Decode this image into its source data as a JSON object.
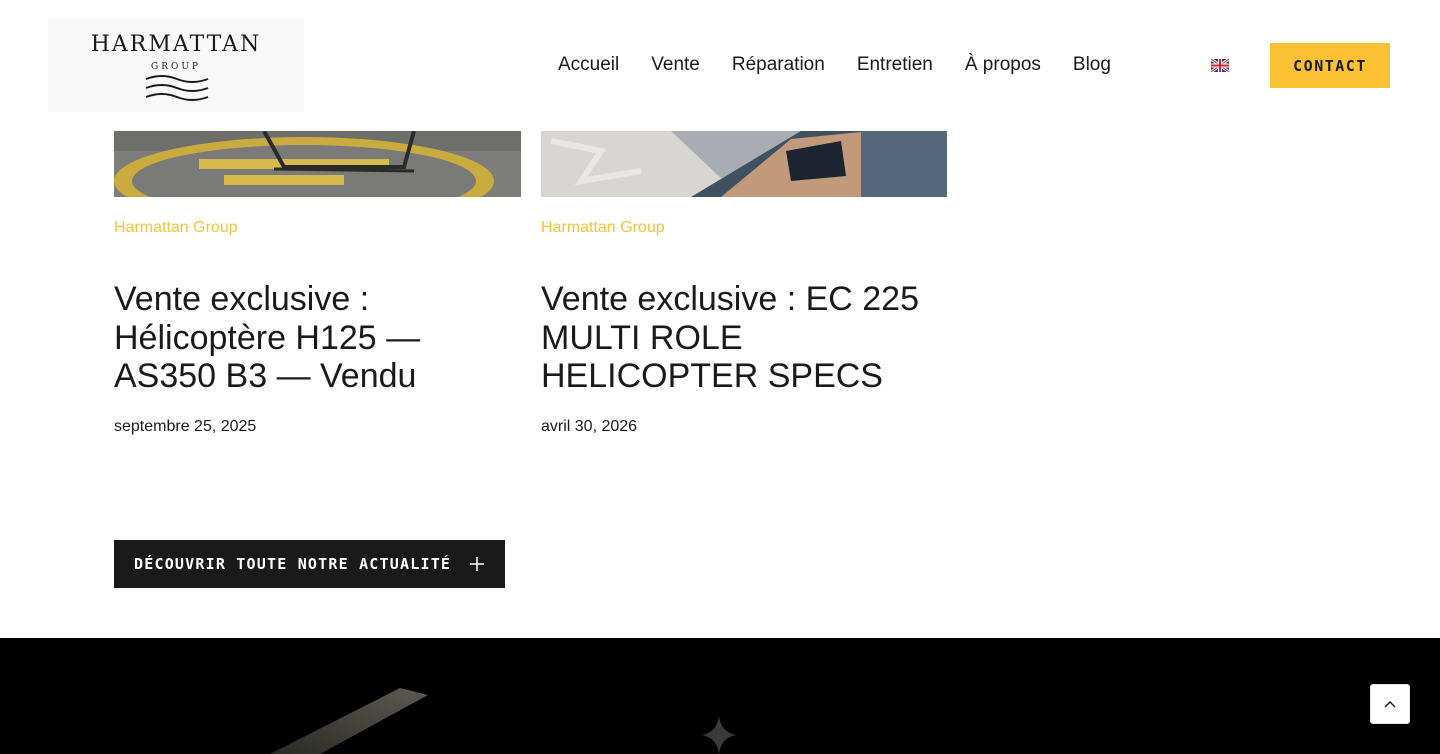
{
  "header": {
    "logo_word": "HARMATTAN",
    "logo_sub": "GROUP",
    "nav": [
      "Accueil",
      "Vente",
      "Réparation",
      "Entretien",
      "À propos",
      "Blog"
    ],
    "language_icon": "uk-flag-icon",
    "contact_label": "CONTACT"
  },
  "cards": [
    {
      "category": "Harmattan Group",
      "title": "Vente exclusive : Hélicoptère H125 — AS350 B3 — Vendu",
      "date": "septembre 25, 2025"
    },
    {
      "category": "Harmattan Group",
      "title": "Vente exclusive : EC 225 MULTI ROLE HELICOPTER SPECS",
      "date": "avril 30, 2026"
    }
  ],
  "cta": {
    "label": "DÉCOUVRIR TOUTE NOTRE ACTUALITÉ",
    "icon": "plus-icon"
  },
  "scroll_top": {
    "icon": "chevron-up-icon"
  },
  "colors": {
    "accent": "#fcc033",
    "category": "#f3c33c",
    "dark": "#1a1a1a",
    "footer_bg": "#000000"
  }
}
